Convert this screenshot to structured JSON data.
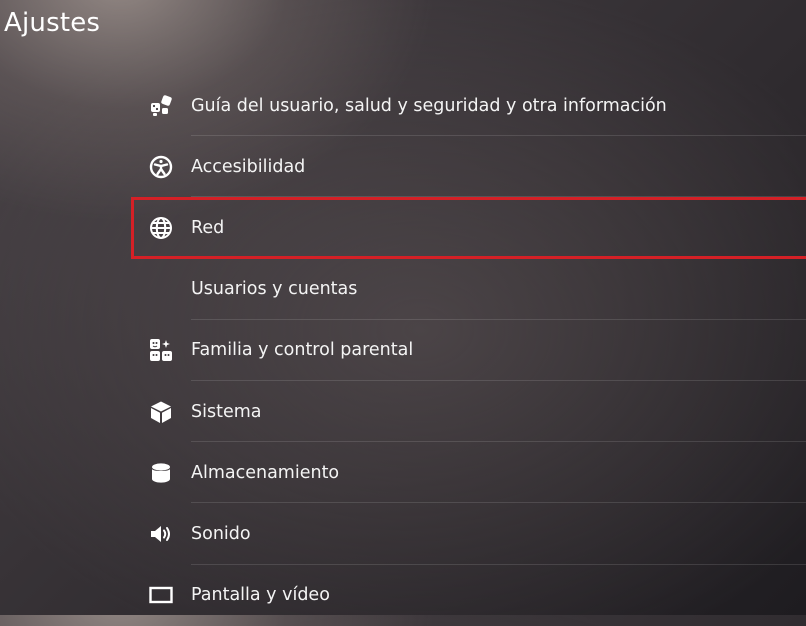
{
  "header": {
    "title": "Ajustes"
  },
  "menu": {
    "accent_color": "#d42026",
    "selected_index": 2,
    "items": [
      {
        "label": "Guía del usuario, salud y seguridad y otra información",
        "icon": "user-guide-icon"
      },
      {
        "label": "Accesibilidad",
        "icon": "accessibility-icon"
      },
      {
        "label": "Red",
        "icon": "globe-icon"
      },
      {
        "label": "Usuarios y cuentas",
        "icon": ""
      },
      {
        "label": "Familia y control parental",
        "icon": "family-icon"
      },
      {
        "label": "Sistema",
        "icon": "cube-icon"
      },
      {
        "label": "Almacenamiento",
        "icon": "storage-icon"
      },
      {
        "label": "Sonido",
        "icon": "speaker-icon"
      },
      {
        "label": "Pantalla y vídeo",
        "icon": "display-icon"
      }
    ]
  }
}
